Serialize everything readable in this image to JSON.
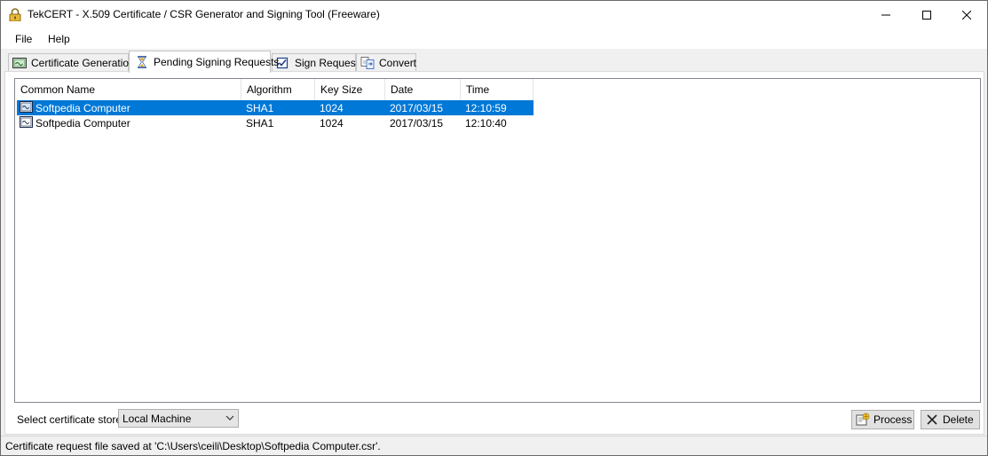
{
  "window": {
    "title": "TekCERT - X.509 Certificate / CSR Generator and Signing Tool (Freeware)"
  },
  "menu": {
    "file": "File",
    "help": "Help"
  },
  "tabs": [
    {
      "label": "Certificate Generation",
      "icon": "certificate-icon"
    },
    {
      "label": "Pending Signing Requests",
      "icon": "hourglass-icon",
      "active": true
    },
    {
      "label": "Sign Request",
      "icon": "checkbox-icon"
    },
    {
      "label": "Convert",
      "icon": "convert-icon"
    }
  ],
  "list": {
    "columns": [
      "Common Name",
      "Algorithm",
      "Key Size",
      "Date",
      "Time"
    ],
    "rows": [
      {
        "common_name": "Softpedia Computer",
        "algorithm": "SHA1",
        "key_size": "1024",
        "date": "2017/03/15",
        "time": "12:10:59",
        "selected": true
      },
      {
        "common_name": "Softpedia Computer",
        "algorithm": "SHA1",
        "key_size": "1024",
        "date": "2017/03/15",
        "time": "12:10:40",
        "selected": false
      }
    ]
  },
  "store": {
    "label": "Select certificate store :",
    "selected": "Local Machine"
  },
  "buttons": {
    "process": "Process",
    "delete": "Delete"
  },
  "status": {
    "text": "Certificate request file saved at 'C:\\Users\\ceili\\Desktop\\Softpedia Computer.csr'."
  },
  "colors": {
    "selection": "#0078d7",
    "window_bg": "#f0f0f0"
  }
}
